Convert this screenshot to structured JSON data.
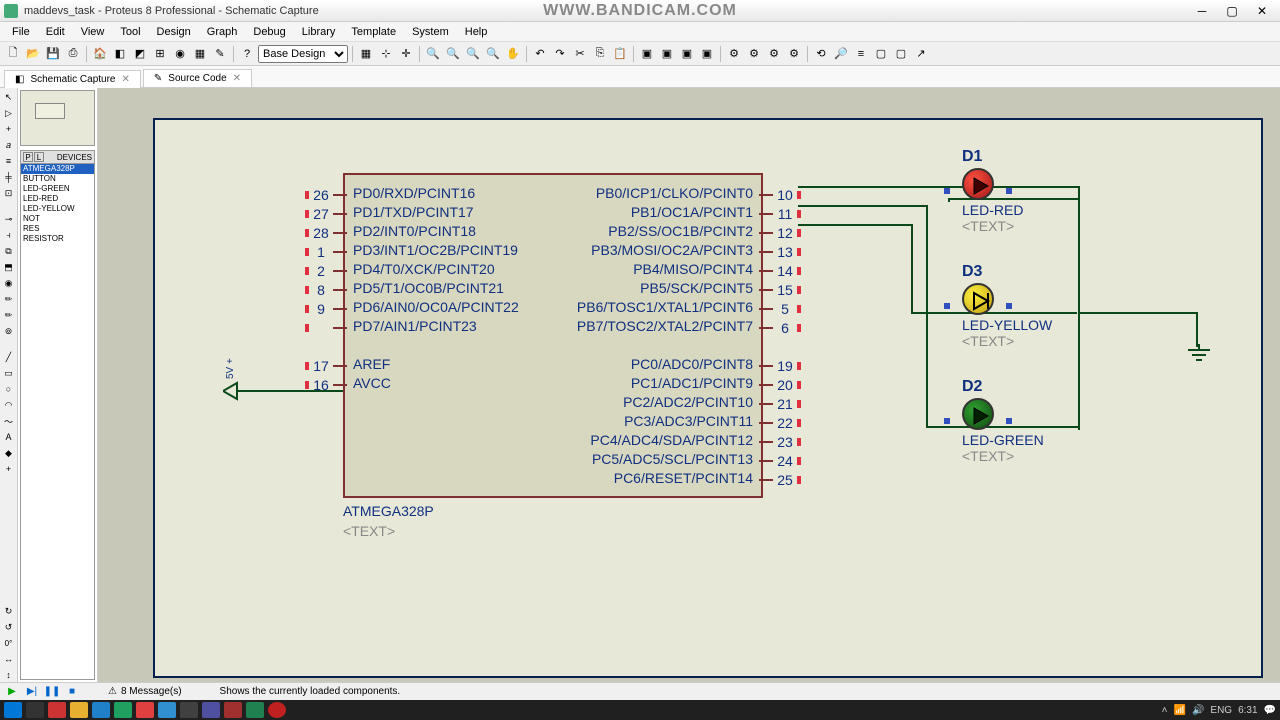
{
  "window": {
    "title": "maddevs_task - Proteus 8 Professional - Schematic Capture",
    "watermark": "WWW.BANDICAM.COM"
  },
  "menu": {
    "items": [
      "File",
      "Edit",
      "View",
      "Tool",
      "Design",
      "Graph",
      "Debug",
      "Library",
      "Template",
      "System",
      "Help"
    ]
  },
  "toolbar": {
    "design_select": "Base Design"
  },
  "tabs": {
    "t1": "Schematic Capture",
    "t2": "Source Code"
  },
  "devices": {
    "header": "DEVICES",
    "items": [
      "ATMEGA328P",
      "BUTTON",
      "LED-GREEN",
      "LED-RED",
      "LED-YELLOW",
      "NOT",
      "RES",
      "RESISTOR"
    ]
  },
  "chip": {
    "name": "ATMEGA328P",
    "text": "<TEXT>",
    "left_pins": [
      {
        "n": "26",
        "l": "PD0/RXD/PCINT16"
      },
      {
        "n": "27",
        "l": "PD1/TXD/PCINT17"
      },
      {
        "n": "28",
        "l": "PD2/INT0/PCINT18"
      },
      {
        "n": "1",
        "l": "PD3/INT1/OC2B/PCINT19"
      },
      {
        "n": "2",
        "l": "PD4/T0/XCK/PCINT20"
      },
      {
        "n": "8",
        "l": "PD5/T1/OC0B/PCINT21"
      },
      {
        "n": "9",
        "l": "PD6/AIN0/OC0A/PCINT22"
      },
      {
        "n": "",
        "l": "PD7/AIN1/PCINT23"
      },
      {
        "n": "17",
        "l": "AREF"
      },
      {
        "n": "16",
        "l": "AVCC"
      }
    ],
    "right_pins": [
      {
        "n": "10",
        "l": "PB0/ICP1/CLKO/PCINT0"
      },
      {
        "n": "11",
        "l": "PB1/OC1A/PCINT1"
      },
      {
        "n": "12",
        "l": "PB2/SS/OC1B/PCINT2"
      },
      {
        "n": "13",
        "l": "PB3/MOSI/OC2A/PCINT3"
      },
      {
        "n": "14",
        "l": "PB4/MISO/PCINT4"
      },
      {
        "n": "15",
        "l": "PB5/SCK/PCINT5"
      },
      {
        "n": "5",
        "l": "PB6/TOSC1/XTAL1/PCINT6"
      },
      {
        "n": "6",
        "l": "PB7/TOSC2/XTAL2/PCINT7"
      },
      {
        "n": "19",
        "l": "PC0/ADC0/PCINT8"
      },
      {
        "n": "20",
        "l": "PC1/ADC1/PCINT9"
      },
      {
        "n": "21",
        "l": "PC2/ADC2/PCINT10"
      },
      {
        "n": "22",
        "l": "PC3/ADC3/PCINT11"
      },
      {
        "n": "23",
        "l": "PC4/ADC4/SDA/PCINT12"
      },
      {
        "n": "24",
        "l": "PC5/ADC5/SCL/PCINT13"
      },
      {
        "n": "25",
        "l": "PC6/RESET/PCINT14"
      }
    ]
  },
  "leds": {
    "d1": {
      "ref": "D1",
      "name": "LED-RED",
      "text": "<TEXT>"
    },
    "d3": {
      "ref": "D3",
      "name": "LED-YELLOW",
      "text": "<TEXT>"
    },
    "d2": {
      "ref": "D2",
      "name": "LED-GREEN",
      "text": "<TEXT>"
    }
  },
  "power": {
    "label": "5V\n+"
  },
  "status": {
    "messages": "8 Message(s)",
    "hint": "Shows the currently loaded components."
  },
  "tray": {
    "lang": "ENG",
    "time": "6:31"
  }
}
